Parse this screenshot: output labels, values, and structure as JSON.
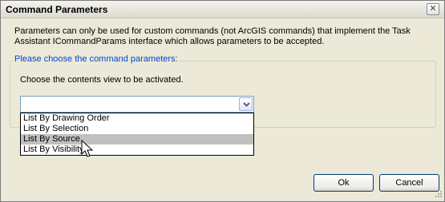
{
  "window": {
    "title": "Command Parameters",
    "close_icon": "close-icon"
  },
  "description": "Parameters can only be used for custom commands (not ArcGIS commands) that implement the Task Assistant ICommandParams interface which allows parameters to be accepted.",
  "group": {
    "legend": "Please choose the command parameters:",
    "label": "Choose the contents view to be activated."
  },
  "combo": {
    "selected_value": "",
    "arrow_icon": "chevron-down-icon",
    "options": [
      "List By Drawing Order",
      "List By Selection",
      "List By Source",
      "List By Visibility"
    ],
    "highlighted_index": 2
  },
  "buttons": {
    "ok": "Ok",
    "cancel": "Cancel"
  }
}
